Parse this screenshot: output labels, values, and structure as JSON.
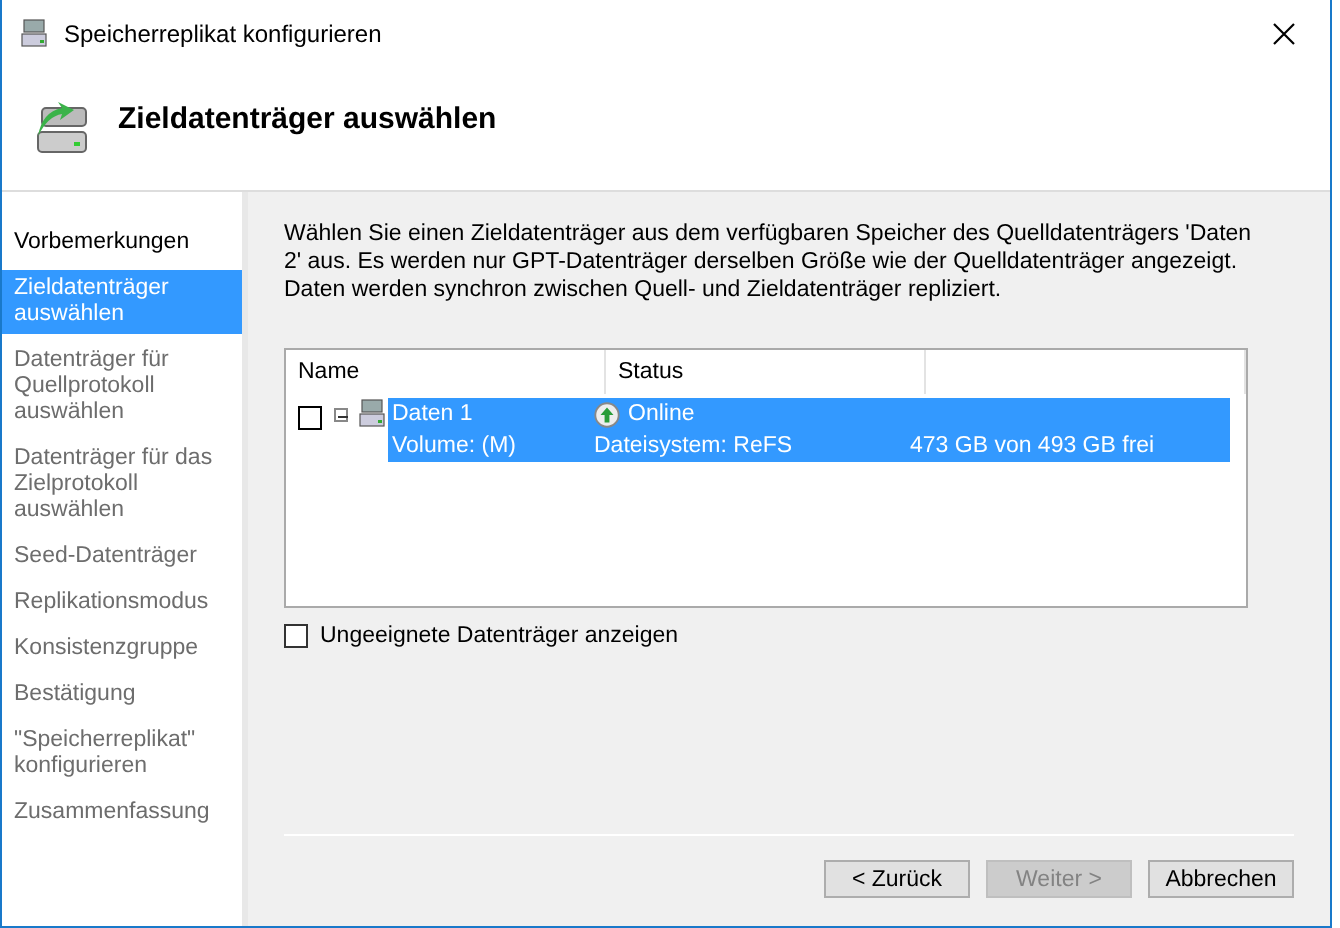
{
  "window": {
    "title": "Speicherreplikat konfigurieren"
  },
  "header": {
    "title": "Zieldatenträger auswählen"
  },
  "steps": [
    {
      "label": "Vorbemerkungen",
      "selected": false,
      "disabled": false
    },
    {
      "label": "Zieldatenträger auswählen",
      "selected": true,
      "disabled": false
    },
    {
      "label": "Datenträger für Quellprotokoll auswählen",
      "selected": false,
      "disabled": true
    },
    {
      "label": "Datenträger für das Zielprotokoll auswählen",
      "selected": false,
      "disabled": true
    },
    {
      "label": "Seed-Datenträger",
      "selected": false,
      "disabled": true
    },
    {
      "label": "Replikationsmodus",
      "selected": false,
      "disabled": true
    },
    {
      "label": "Konsistenzgruppe",
      "selected": false,
      "disabled": true
    },
    {
      "label": "Bestätigung",
      "selected": false,
      "disabled": true
    },
    {
      "label": "\"Speicherreplikat\" konfigurieren",
      "selected": false,
      "disabled": true
    },
    {
      "label": "Zusammenfassung",
      "selected": false,
      "disabled": true
    }
  ],
  "description": "Wählen Sie einen Zieldatenträger aus dem verfügbaren Speicher des Quelldatenträgers 'Daten 2' aus. Es werden nur GPT-Datenträger derselben Größe wie der Quelldatenträger angezeigt. Daten werden synchron zwischen Quell- und Zieldatenträger repliziert.",
  "table": {
    "columns": [
      "Name",
      "Status"
    ],
    "rows": [
      {
        "name": "Daten 1",
        "volume": "Volume: (M)",
        "status": "Online",
        "filesystem": "Dateisystem: ReFS",
        "free": "473 GB von 493 GB frei",
        "checked": false,
        "expanded": true,
        "selected": true
      }
    ]
  },
  "show_unsuitable": {
    "label": "Ungeeignete Datenträger anzeigen",
    "checked": false
  },
  "buttons": [
    {
      "label": "< Zurück",
      "disabled": false
    },
    {
      "label": "Weiter >",
      "disabled": true
    },
    {
      "label": "Abbrechen",
      "disabled": false
    }
  ]
}
